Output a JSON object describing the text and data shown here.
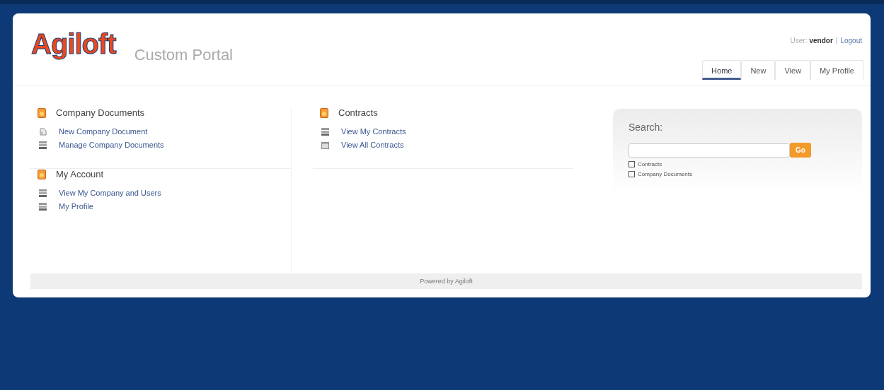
{
  "header": {
    "logo": "Agiloft",
    "portal_title": "Custom Portal",
    "user_label": "User:",
    "user_name": "vendor",
    "separator": "|",
    "logout": "Logout"
  },
  "tabs": [
    {
      "label": "Home",
      "selected": true
    },
    {
      "label": "New",
      "selected": false
    },
    {
      "label": "View",
      "selected": false
    },
    {
      "label": "My Profile",
      "selected": false
    }
  ],
  "columns": [
    [
      {
        "title": "Company Documents",
        "links": [
          {
            "label": "New Company Document",
            "kind": "new"
          },
          {
            "label": "Manage Company Documents",
            "kind": "list"
          }
        ]
      },
      {
        "title": "My Account",
        "links": [
          {
            "label": "View My Company and Users",
            "kind": "list"
          },
          {
            "label": "My Profile",
            "kind": "list"
          }
        ]
      }
    ],
    [
      {
        "title": "Contracts",
        "links": [
          {
            "label": "View My Contracts",
            "kind": "list"
          },
          {
            "label": "View All Contracts",
            "kind": "folder"
          }
        ]
      }
    ]
  ],
  "search": {
    "title": "Search:",
    "button": "Go",
    "options": [
      {
        "label": "Contracts",
        "checked": false
      },
      {
        "label": "Company Documents",
        "checked": false
      }
    ]
  },
  "footer": "Powered by Agiloft"
}
